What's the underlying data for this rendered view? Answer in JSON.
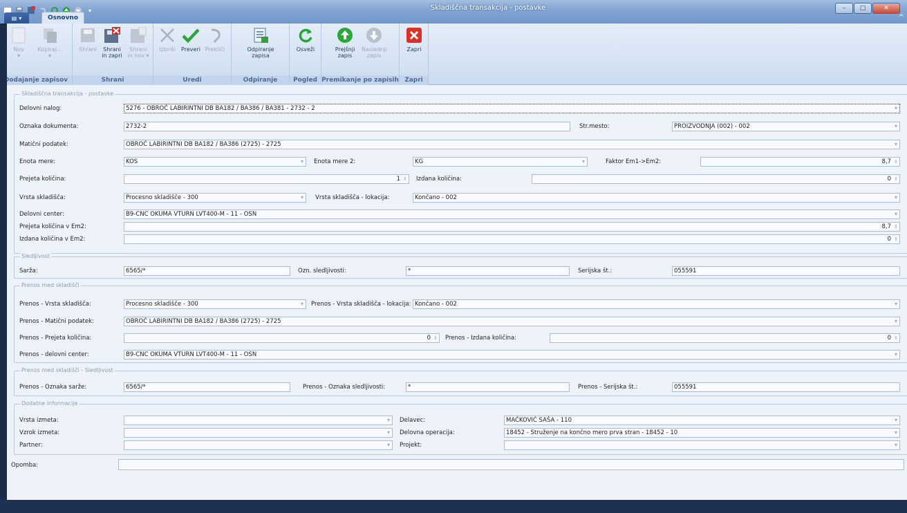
{
  "window": {
    "title": "Skladiščna transakcija - postavke"
  },
  "tabs": {
    "osnovno": "Osnovno"
  },
  "ribbon": {
    "nov": "Nov",
    "kopiraj": "Kopiraj...",
    "shrani": "Shrani",
    "shrani_in_zapri": "Shrani in zapri",
    "shrani_in_nov": "Shrani in nov",
    "izbrisi": "Izbriši",
    "preveri": "Preveri",
    "prekini": "Prekliči",
    "odpiranje": "Odpiranje zapisa",
    "osvezi": "Osveži",
    "prejsnji": "Prejšnji zapis",
    "naslednji": "Naslednji zapis",
    "zapri": "Zapri",
    "groups": {
      "dodajanje": "Dodajanje zapisov",
      "shrani": "Shrani",
      "uredi": "Uredi",
      "odpiranje": "Odpiranje zapisa",
      "pogled": "Pogled",
      "premikanje": "Premikanje po zapisih",
      "zapri": "Zapri"
    }
  },
  "sec1": {
    "title": "Skladiščna transakcija - postavke",
    "delovni_nalog_label": "Delovni nalog:",
    "delovni_nalog": "5276 - OBROČ LABIRINTNI DB BA182 / BA386 / BA381 - 2732 - 2",
    "oznaka_label": "Oznaka dokumenta:",
    "oznaka": "2732-2",
    "strmesto_label": "Str.mesto:",
    "strmesto": "PROIZVODNJA (002) - 002",
    "maticni_label": "Matični podatek:",
    "maticni": "OBROČ LABIRINTNI DB BA182 / BA386 (2725) - 2725",
    "enota_label": "Enota mere:",
    "enota": "KOS",
    "enota2_label": "Enota mere 2:",
    "enota2": "KG",
    "faktor_label": "Faktor Em1->Em2:",
    "faktor": "8,7",
    "prejeta_label": "Prejeta količina:",
    "prejeta": "1",
    "izdana_label": "Izdana količina:",
    "izdana": "0",
    "vrsta_label": "Vrsta skladišča:",
    "vrsta": "Procesno skladišče - 300",
    "lokacija_label": "Vrsta skladišča - lokacija:",
    "lokacija": "Končano - 002",
    "center_label": "Delovni center:",
    "center": "B9-CNC OKUMA VTURN LVT400-M - 11 - OSN",
    "prejeta_em2_label": "Prejeta količina v Em2:",
    "prejeta_em2": "8,7",
    "izdana_em2_label": "Izdana količina v Em2:",
    "izdana_em2": "0"
  },
  "sec2": {
    "title": "Sledljivost",
    "sarza_label": "Sarža:",
    "sarza": "6565/*",
    "ozn_label": "Ozn. sledljivosti:",
    "ozn": "*",
    "serijska_label": "Serijska št.:",
    "serijska": "055591"
  },
  "sec3": {
    "title": "Prenos med skladišči",
    "vrsta_label": "Prenos - Vrsta skladišča:",
    "vrsta": "Procesno skladišče - 300",
    "lokacija_label": "Prenos - Vrsta skladišča - lokacija:",
    "lokacija": "Končano - 002",
    "maticni_label": "Prenos - Matični podatek:",
    "maticni": "OBROČ LABIRINTNI DB BA182 / BA386 (2725) - 2725",
    "prejeta_label": "Prenos - Prejeta količina:",
    "prejeta": "0",
    "izdana_label": "Prenos - Izdana količina:",
    "izdana": "0",
    "center_label": "Prenos - delovni center:",
    "center": "B9-CNC OKUMA VTURN LVT400-M - 11 - OSN"
  },
  "sec4": {
    "title": "Prenos med skladišči - Sledljivost",
    "sarza_label": "Prenos - Oznaka sarže:",
    "sarza": "6565/*",
    "ozn_label": "Prenos - Oznaka sledljivosti:",
    "ozn": "*",
    "serijska_label": "Prenos - Serijska št.:",
    "serijska": "055591"
  },
  "sec5": {
    "title": "Dodatne informacije",
    "vrsta_label": "Vrsta izmeta:",
    "vzrok_label": "Vzrok izmeta:",
    "partner_label": "Partner:",
    "delavec_label": "Delavec:",
    "delavec": "MAČKOVIČ SAŠA - 110",
    "operacija_label": "Delovna operacija:",
    "operacija": "18452 - Struženje na končno mero prva stran - 18452 - 10",
    "projekt_label": "Projekt:"
  },
  "opomba_label": "Opomba:"
}
